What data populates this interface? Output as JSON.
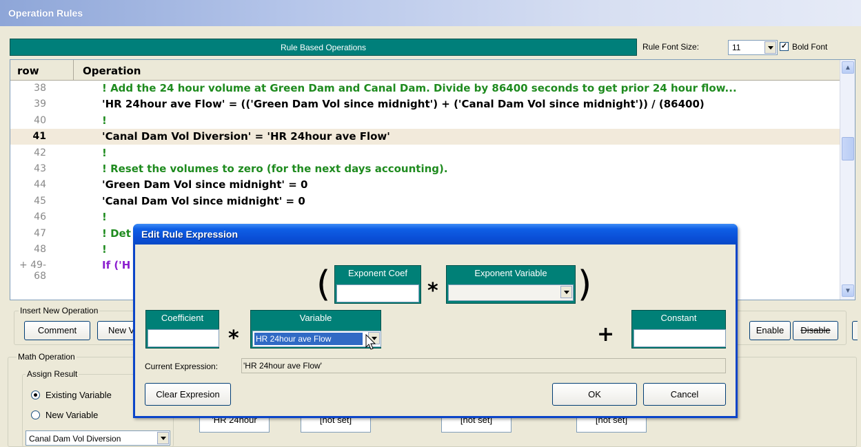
{
  "window": {
    "title": "Operation Rules"
  },
  "header": {
    "title": "Rule Based Operations",
    "font_size_label": "Rule Font Size:",
    "font_size_value": "11",
    "bold_font_label": "Bold Font",
    "bold_font_checked": "✓"
  },
  "grid": {
    "col_row": "row",
    "col_operation": "Operation",
    "rows": [
      {
        "num": "38",
        "text": "! Add the 24 hour volume at Green Dam and Canal Dam.  Divide by 86400 seconds to get prior 24 hour flow...",
        "kind": "comment"
      },
      {
        "num": "39",
        "text": "'HR 24hour ave Flow' = (('Green Dam Vol since midnight') + ('Canal Dam Vol since midnight')) / (86400)",
        "kind": "code"
      },
      {
        "num": "40",
        "text": "!",
        "kind": "comment"
      },
      {
        "num": "41",
        "text": "'Canal Dam Vol Diversion' = 'HR 24hour ave Flow'",
        "kind": "code"
      },
      {
        "num": "42",
        "text": "!",
        "kind": "comment"
      },
      {
        "num": "43",
        "text": "! Reset the volumes to zero (for the next days accounting).",
        "kind": "comment"
      },
      {
        "num": "44",
        "text": "'Green Dam Vol since midnight' = 0",
        "kind": "code"
      },
      {
        "num": "45",
        "text": "'Canal Dam Vol since midnight' = 0",
        "kind": "code"
      },
      {
        "num": "46",
        "text": "!",
        "kind": "comment"
      },
      {
        "num": "47",
        "text": "! Det",
        "kind": "comment"
      },
      {
        "num": "48",
        "text": "!",
        "kind": "comment"
      },
      {
        "num": "+ 49-68",
        "text": "If ('H",
        "kind": "ctrl"
      }
    ],
    "selected_row": "41"
  },
  "insert_panel": {
    "label": "Insert New Operation",
    "comment_button": "Comment",
    "new_button": "New V"
  },
  "right_panel": {
    "enable_button": "Enable",
    "disable_button": "Disable"
  },
  "math_panel": {
    "label": "Math Operation",
    "assign_label": "Assign Result",
    "existing_variable": "Existing Variable",
    "new_variable": "New Variable",
    "selected_variable": "Canal Dam Vol Diversion",
    "slot_values": [
      "'HR 24hour",
      "[not set]",
      "[not set]",
      "[not set]"
    ]
  },
  "dialog": {
    "title": "Edit Rule Expression",
    "open_paren": "(",
    "close_paren": ")",
    "times": "*",
    "plus": "+",
    "exponent_coef_label": "Exponent Coef",
    "exponent_coef_value": "",
    "exponent_variable_label": "Exponent Variable",
    "exponent_variable_value": "",
    "coefficient_label": "Coefficient",
    "coefficient_value": "",
    "variable_label": "Variable",
    "variable_value": "HR 24hour ave Flow",
    "constant_label": "Constant",
    "constant_value": "",
    "current_expression_label": "Current Expression:",
    "current_expression_value": "'HR 24hour ave Flow'",
    "clear_button": "Clear Expresion",
    "ok_button": "OK",
    "cancel_button": "Cancel"
  }
}
